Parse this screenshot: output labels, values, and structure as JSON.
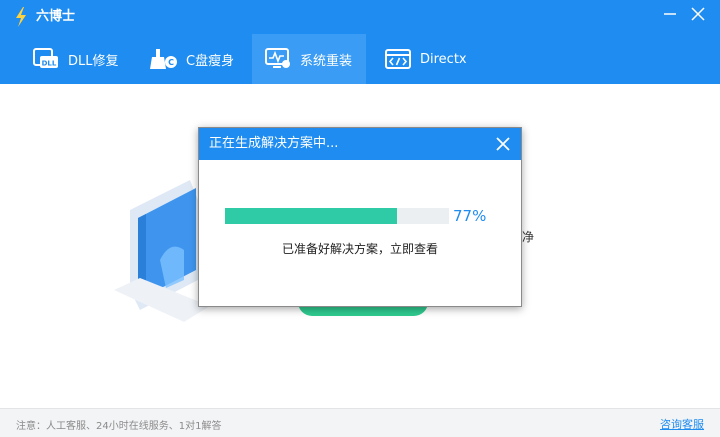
{
  "app": {
    "title": "六博士"
  },
  "tabs": [
    {
      "label": "DLL修复",
      "icon": "dll-icon"
    },
    {
      "label": "C盘瘦身",
      "icon": "broom-icon"
    },
    {
      "label": "系统重装",
      "icon": "monitor-icon"
    },
    {
      "label": "Directx",
      "icon": "directx-icon"
    }
  ],
  "active_tab": "系统重装",
  "background": {
    "partial_text": "净"
  },
  "dialog": {
    "title": "正在生成解决方案中...",
    "progress": 0.77,
    "percent_label": "77%",
    "status": "已准备好解决方案，立即查看"
  },
  "footer": {
    "note": "注意：人工客服、24小时在线服务、1对1解答",
    "consult": "咨询客服"
  },
  "colors": {
    "primary": "#1e8cf0",
    "progress": "#2ecba6",
    "accent_green": "#2fcb8f"
  }
}
